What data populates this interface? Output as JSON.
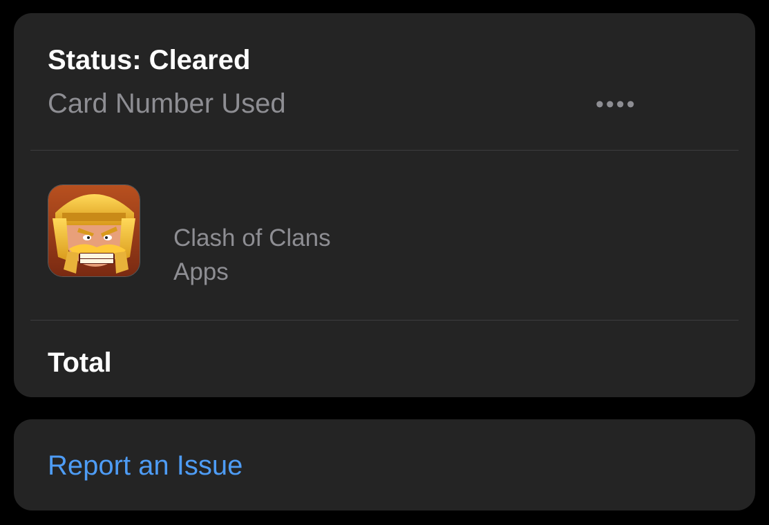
{
  "purchase": {
    "status": "Status: Cleared",
    "card_label": "Card Number Used",
    "card_masked": "••••",
    "item": {
      "name": "Clash of Clans",
      "category": "Apps",
      "icon": "clash-of-clans-app-icon"
    },
    "total_label": "Total"
  },
  "actions": {
    "report_issue": "Report an Issue"
  },
  "colors": {
    "background": "#000000",
    "card": "#242424",
    "primary_text": "#ffffff",
    "secondary_text": "#8e8e93",
    "link": "#4e9cf5"
  }
}
